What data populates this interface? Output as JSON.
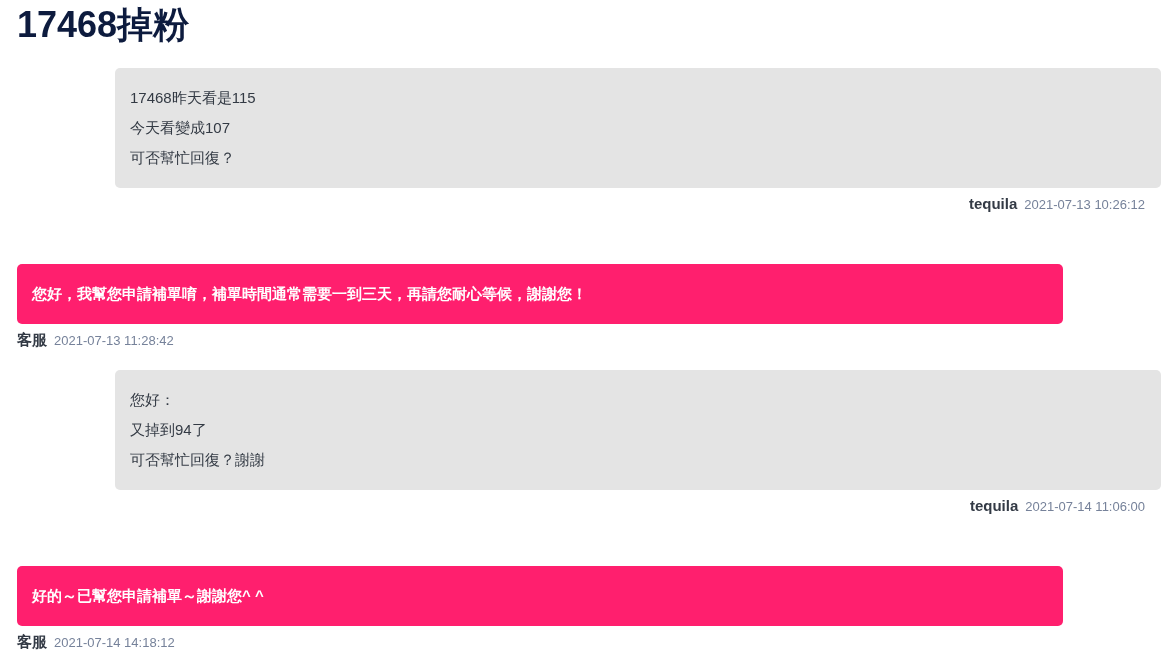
{
  "title": "17468掉粉",
  "messages": [
    {
      "kind": "user",
      "lines": [
        "17468昨天看是115",
        "今天看變成107",
        "可否幫忙回復？"
      ],
      "sender": "tequila",
      "time": "2021-07-13 10:26:12"
    },
    {
      "kind": "staff",
      "lines": [
        "您好，我幫您申請補單唷，補單時間通常需要一到三天，再請您耐心等候，謝謝您！"
      ],
      "sender": "客服",
      "time": "2021-07-13 11:28:42"
    },
    {
      "kind": "user",
      "lines": [
        "您好：",
        "又掉到94了",
        "可否幫忙回復？謝謝"
      ],
      "sender": "tequila",
      "time": "2021-07-14 11:06:00"
    },
    {
      "kind": "staff",
      "lines": [
        "好的～已幫您申請補單～謝謝您^ ^"
      ],
      "sender": "客服",
      "time": "2021-07-14 14:18:12"
    }
  ]
}
